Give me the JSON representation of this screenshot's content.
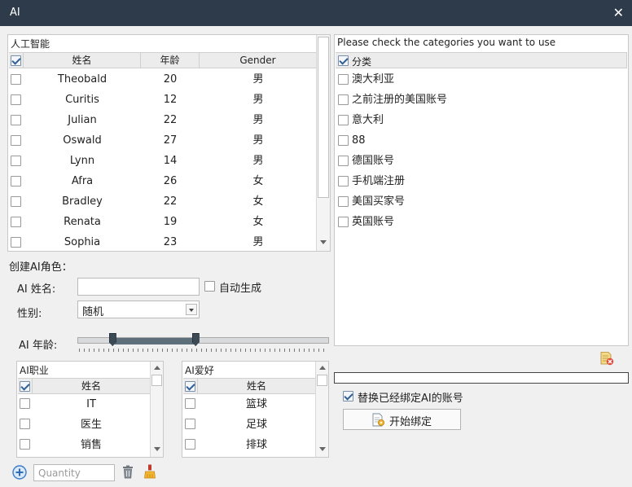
{
  "window": {
    "title": "AI",
    "close_glyph": "✕"
  },
  "ai_table": {
    "caption": "人工智能",
    "headers": [
      "姓名",
      "年龄",
      "Gender"
    ],
    "rows": [
      {
        "name": "Theobald",
        "age": "20",
        "gender": "男"
      },
      {
        "name": "Curitis",
        "age": "12",
        "gender": "男"
      },
      {
        "name": "Julian",
        "age": "22",
        "gender": "男"
      },
      {
        "name": "Oswald",
        "age": "27",
        "gender": "男"
      },
      {
        "name": "Lynn",
        "age": "14",
        "gender": "男"
      },
      {
        "name": "Afra",
        "age": "26",
        "gender": "女"
      },
      {
        "name": "Bradley",
        "age": "22",
        "gender": "女"
      },
      {
        "name": "Renata",
        "age": "19",
        "gender": "女"
      },
      {
        "name": "Sophia",
        "age": "23",
        "gender": "男"
      }
    ]
  },
  "create": {
    "heading": "创建AI角色：",
    "name_label": "AI 姓名:",
    "name_value": "",
    "auto_label": "自动生成",
    "gender_label": "性别:",
    "gender_value": "随机",
    "age_label": "AI 年龄:",
    "age_range": {
      "min_fraction": 0.14,
      "max_fraction": 0.47
    }
  },
  "occupation": {
    "caption": "AI职业",
    "header": "姓名",
    "rows": [
      "IT",
      "医生",
      "销售"
    ]
  },
  "hobby": {
    "caption": "AI爱好",
    "header": "姓名",
    "rows": [
      "篮球",
      "足球",
      "排球"
    ]
  },
  "bottom": {
    "quantity_placeholder": "Quantity"
  },
  "categories": {
    "caption": "Please check the categories you want to use",
    "header": "分类",
    "items": [
      "澳大利亚",
      "之前注册的美国账号",
      "意大利",
      "88",
      "德国账号",
      "手机端注册",
      "美国买家号",
      "英国账号"
    ]
  },
  "right_bottom": {
    "progress": 0,
    "replace_label": "替换已经绑定AI的账号",
    "replace_checked": true,
    "start_label": "开始绑定"
  },
  "colors": {
    "titlebar": "#2d3b4a",
    "accent": "#2f5f96",
    "slider": "#5e6f7c"
  }
}
